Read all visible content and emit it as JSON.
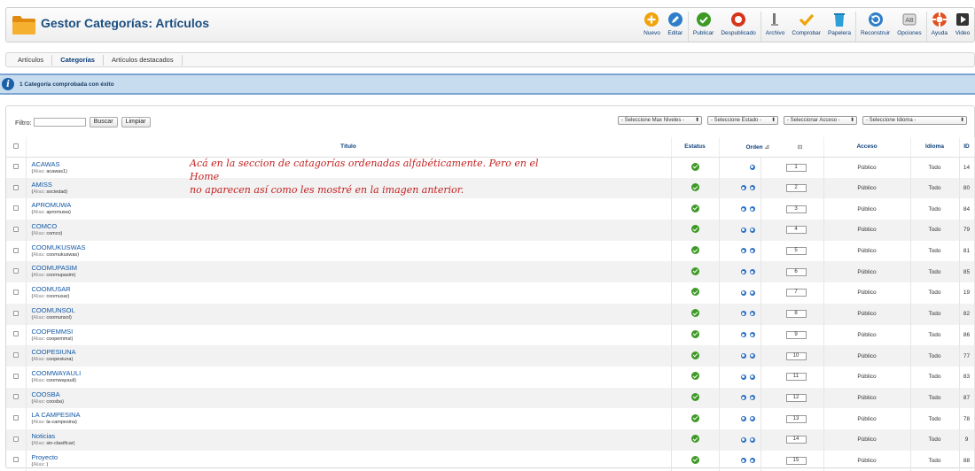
{
  "header": {
    "title": "Gestor Categorías: Artículos",
    "toolbar": [
      {
        "label": "Nuevo",
        "icon": "plus-circle-icon",
        "color": "#f0a30a"
      },
      {
        "label": "Editar",
        "icon": "pencil-icon",
        "color": "#2f7fc8"
      },
      {
        "label": "Publicar",
        "icon": "check-circle-icon",
        "color": "#3d9a24"
      },
      {
        "label": "Despublicado",
        "icon": "stop-circle-icon",
        "color": "#d6351c"
      },
      {
        "label": "Archivo",
        "icon": "archive-icon",
        "color": "#777777"
      },
      {
        "label": "Comprobar",
        "icon": "checkmark-icon",
        "color": "#f0a30a"
      },
      {
        "label": "Papelera",
        "icon": "trash-icon",
        "color": "#2f9fd8"
      },
      {
        "label": "Reconstruir",
        "icon": "refresh-icon",
        "color": "#2f7fc8"
      },
      {
        "label": "Opciones",
        "icon": "options-icon",
        "color": "#888888"
      },
      {
        "label": "Ayuda",
        "icon": "help-icon",
        "color": "#e05020"
      },
      {
        "label": "Video",
        "icon": "video-icon",
        "color": "#333333"
      }
    ]
  },
  "submenu": {
    "tabs": [
      {
        "label": "Artículos",
        "active": false
      },
      {
        "label": "Categorías",
        "active": true
      },
      {
        "label": "Artículos destacados",
        "active": false
      }
    ]
  },
  "message": {
    "text": "1 Categoría comprobada con éxito"
  },
  "filter": {
    "label": "Filtro:",
    "value": "",
    "search_button": "Buscar",
    "clear_button": "Limpiar",
    "selects": [
      "- Seleccione Max Niveles -",
      "- Seleccione Estado -",
      "- Seleccionar Acceso -",
      "- Seleccione Idioma -"
    ]
  },
  "table": {
    "columns": {
      "title": "Título",
      "status": "Estatus",
      "order": "Orden",
      "access": "Acceso",
      "language": "Idioma",
      "id": "ID"
    },
    "alias_label": "Alias",
    "rows": [
      {
        "title": "ACAWAS",
        "alias": "acawas1",
        "order": "1",
        "access": "Público",
        "language": "Todo",
        "id": "14",
        "arrows": 1
      },
      {
        "title": "AMISS",
        "alias": "sociedad",
        "order": "2",
        "access": "Público",
        "language": "Todo",
        "id": "80",
        "arrows": 2
      },
      {
        "title": "APROMUWA",
        "alias": "apromuwa",
        "order": "3",
        "access": "Público",
        "language": "Todo",
        "id": "84",
        "arrows": 2
      },
      {
        "title": "COMCO",
        "alias": "comco",
        "order": "4",
        "access": "Público",
        "language": "Todo",
        "id": "79",
        "arrows": 2
      },
      {
        "title": "COOMUKUSWAS",
        "alias": "coomukuswas",
        "order": "5",
        "access": "Público",
        "language": "Todo",
        "id": "81",
        "arrows": 2
      },
      {
        "title": "COOMUPASIM",
        "alias": "coomupasim",
        "order": "6",
        "access": "Público",
        "language": "Todo",
        "id": "85",
        "arrows": 2
      },
      {
        "title": "COOMUSAR",
        "alias": "coomusar",
        "order": "7",
        "access": "Público",
        "language": "Todo",
        "id": "19",
        "arrows": 2
      },
      {
        "title": "COOMUNSOL",
        "alias": "coomunsol",
        "order": "8",
        "access": "Público",
        "language": "Todo",
        "id": "82",
        "arrows": 2
      },
      {
        "title": "COOPEMMSI",
        "alias": "coopemmsi",
        "order": "9",
        "access": "Público",
        "language": "Todo",
        "id": "86",
        "arrows": 2
      },
      {
        "title": "COOPESIUNA",
        "alias": "coopesiuna",
        "order": "10",
        "access": "Público",
        "language": "Todo",
        "id": "77",
        "arrows": 2
      },
      {
        "title": "COOMWAYAULI",
        "alias": "coomwayauli",
        "order": "11",
        "access": "Público",
        "language": "Todo",
        "id": "83",
        "arrows": 2
      },
      {
        "title": "COOSBA",
        "alias": "coosba",
        "order": "12",
        "access": "Público",
        "language": "Todo",
        "id": "87",
        "arrows": 2
      },
      {
        "title": "LA CAMPESINA",
        "alias": "la-campesina",
        "order": "13",
        "access": "Público",
        "language": "Todo",
        "id": "78",
        "arrows": 2
      },
      {
        "title": "Noticias",
        "alias": "sin-clasificar",
        "order": "14",
        "access": "Público",
        "language": "Todo",
        "id": "9",
        "arrows": 2
      },
      {
        "title": "Proyecto",
        "alias": "",
        "order": "15",
        "access": "Público",
        "language": "Todo",
        "id": "88",
        "arrows": 2
      }
    ]
  },
  "annotation": {
    "line1": "Acá en la seccion de catagorías ordenadas alfabéticamente. Pero en el Home",
    "line2": "no aparecen así como les mostré en la imagen anterior."
  }
}
